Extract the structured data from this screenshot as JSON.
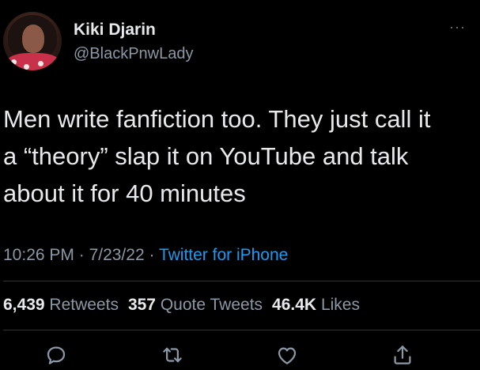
{
  "user": {
    "display_name": "Kiki Djarin",
    "handle": "@BlackPnwLady"
  },
  "more_menu": "···",
  "tweet": {
    "text_lines": [
      "Men write fanfiction too. They just call it",
      "a “theory” slap it on YouTube and talk",
      "about it for 40 minutes"
    ]
  },
  "meta": {
    "time": "10:26 PM",
    "separator": " · ",
    "date": "7/23/22",
    "source": "Twitter for iPhone"
  },
  "stats": {
    "retweets_count": "6,439",
    "retweets_label": "Retweets",
    "quotes_count": "357",
    "quotes_label": "Quote Tweets",
    "likes_count": "46.4K",
    "likes_label": "Likes"
  },
  "actions": {
    "icons": [
      "reply-icon",
      "retweet-icon",
      "like-icon",
      "share-icon"
    ]
  },
  "colors": {
    "background": "#000000",
    "text": "#e7e9ea",
    "secondary": "#8b98a5",
    "link": "#1d9bf0",
    "divider": "#2f3336"
  }
}
